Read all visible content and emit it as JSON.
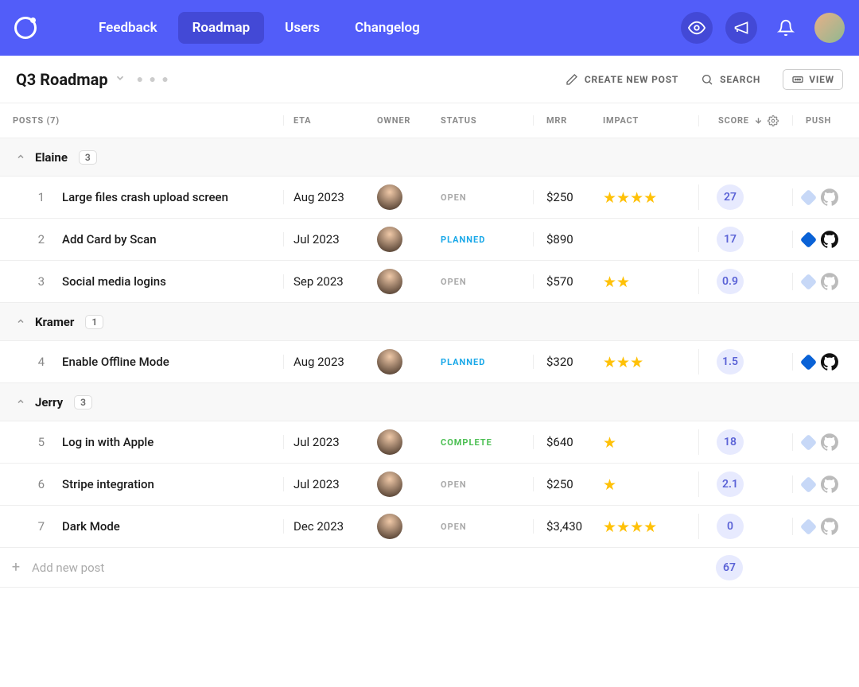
{
  "nav": {
    "links": [
      "Feedback",
      "Roadmap",
      "Users",
      "Changelog"
    ],
    "active": "Roadmap"
  },
  "subheader": {
    "title": "Q3 Roadmap",
    "create": "CREATE NEW POST",
    "search": "SEARCH",
    "view": "VIEW"
  },
  "columns": {
    "posts": "POSTS (7)",
    "eta": "ETA",
    "owner": "OWNER",
    "status": "STATUS",
    "mrr": "MRR",
    "impact": "IMPACT",
    "score": "SCORE",
    "push": "PUSH"
  },
  "groups": [
    {
      "name": "Elaine",
      "count": "3",
      "rows": [
        {
          "idx": "1",
          "title": "Large files crash upload screen",
          "eta": "Aug 2023",
          "status": "OPEN",
          "status_class": "open",
          "mrr": "$250",
          "stars": 4,
          "score": "27",
          "push_active": false
        },
        {
          "idx": "2",
          "title": "Add Card by Scan",
          "eta": "Jul 2023",
          "status": "PLANNED",
          "status_class": "planned",
          "mrr": "$890",
          "stars": 0,
          "score": "17",
          "push_active": true
        },
        {
          "idx": "3",
          "title": "Social media logins",
          "eta": "Sep 2023",
          "status": "OPEN",
          "status_class": "open",
          "mrr": "$570",
          "stars": 2,
          "score": "0.9",
          "push_active": false
        }
      ]
    },
    {
      "name": "Kramer",
      "count": "1",
      "rows": [
        {
          "idx": "4",
          "title": "Enable Offline Mode",
          "eta": "Aug 2023",
          "status": "PLANNED",
          "status_class": "planned",
          "mrr": "$320",
          "stars": 3,
          "score": "1.5",
          "push_active": true
        }
      ]
    },
    {
      "name": "Jerry",
      "count": "3",
      "rows": [
        {
          "idx": "5",
          "title": "Log in with Apple",
          "eta": "Jul 2023",
          "status": "COMPLETE",
          "status_class": "complete",
          "mrr": "$640",
          "stars": 1,
          "score": "18",
          "push_active": false
        },
        {
          "idx": "6",
          "title": "Stripe integration",
          "eta": "Jul 2023",
          "status": "OPEN",
          "status_class": "open",
          "mrr": "$250",
          "stars": 1,
          "score": "2.1",
          "push_active": false
        },
        {
          "idx": "7",
          "title": "Dark Mode",
          "eta": "Dec 2023",
          "status": "OPEN",
          "status_class": "open",
          "mrr": "$3,430",
          "stars": 4,
          "score": "0",
          "push_active": false
        }
      ]
    }
  ],
  "footer": {
    "add": "Add new post",
    "total_score": "67"
  }
}
